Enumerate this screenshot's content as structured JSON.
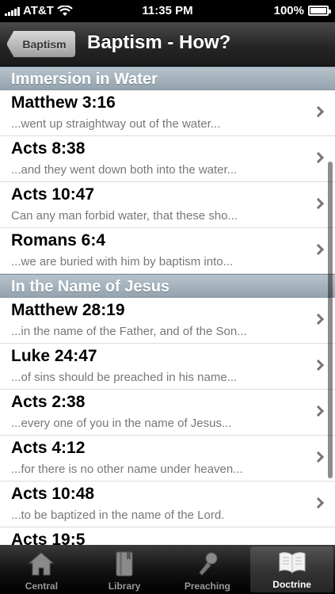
{
  "status": {
    "carrier": "AT&T",
    "time": "11:35 PM",
    "battery": "100%",
    "battery_level": 1.0
  },
  "nav": {
    "back_label": "Baptism",
    "title": "Baptism - How?"
  },
  "sections": [
    {
      "title": "Immersion in Water",
      "rows": [
        {
          "title": "Matthew 3:16",
          "subtitle": "...went up straightway out of the water..."
        },
        {
          "title": "Acts 8:38",
          "subtitle": "...and they went down both into the water..."
        },
        {
          "title": "Acts 10:47",
          "subtitle": "Can any man forbid water, that these sho..."
        },
        {
          "title": "Romans 6:4",
          "subtitle": "...we are buried with him by baptism into..."
        }
      ]
    },
    {
      "title": "In the Name of Jesus",
      "rows": [
        {
          "title": "Matthew 28:19",
          "subtitle": "...in the name of the Father, and of the Son..."
        },
        {
          "title": "Luke 24:47",
          "subtitle": "...of sins should be preached in his name..."
        },
        {
          "title": "Acts 2:38",
          "subtitle": "...every one of you in the name of Jesus..."
        },
        {
          "title": "Acts 4:12",
          "subtitle": "...for there is no other name under heaven..."
        },
        {
          "title": "Acts 10:48",
          "subtitle": "...to be baptized in the name of the Lord."
        },
        {
          "title": "Acts 19:5",
          "subtitle": ""
        }
      ]
    }
  ],
  "tabs": [
    {
      "label": "Central",
      "icon": "house-icon"
    },
    {
      "label": "Library",
      "icon": "book-icon"
    },
    {
      "label": "Preaching",
      "icon": "microphone-icon"
    },
    {
      "label": "Doctrine",
      "icon": "open-book-icon",
      "active": true
    }
  ]
}
